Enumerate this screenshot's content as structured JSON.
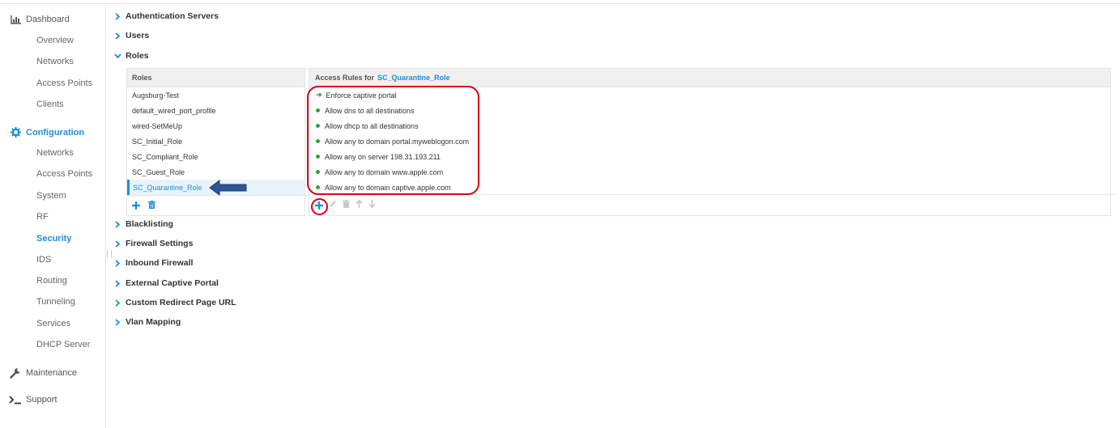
{
  "sidebar": {
    "dashboard": {
      "label": "Dashboard",
      "icon": "bar-chart-icon",
      "items": [
        "Overview",
        "Networks",
        "Access Points",
        "Clients"
      ]
    },
    "configuration": {
      "label": "Configuration",
      "icon": "gear-icon",
      "items": [
        "Networks",
        "Access Points",
        "System",
        "RF",
        "Security",
        "IDS",
        "Routing",
        "Tunneling",
        "Services",
        "DHCP Server"
      ],
      "active": "Security"
    },
    "maintenance": {
      "label": "Maintenance",
      "icon": "wrench-icon"
    },
    "support": {
      "label": "Support",
      "icon": "terminal-icon"
    }
  },
  "sections_top": [
    {
      "label": "Authentication Servers",
      "expanded": false
    },
    {
      "label": "Users",
      "expanded": false
    },
    {
      "label": "Roles",
      "expanded": true
    }
  ],
  "sections_bottom": [
    {
      "label": "Blacklisting"
    },
    {
      "label": "Firewall Settings"
    },
    {
      "label": "Inbound Firewall"
    },
    {
      "label": "External Captive Portal"
    },
    {
      "label": "Custom Redirect Page URL"
    },
    {
      "label": "Vlan Mapping"
    }
  ],
  "roles": {
    "header": "Roles",
    "items": [
      "Augsburg-Test",
      "default_wired_port_profile",
      "wired-SetMeUp",
      "SC_Initial_Role",
      "SC_Compliant_Role",
      "SC_Guest_Role",
      "SC_Quarantine_Role"
    ],
    "selected": "SC_Quarantine_Role"
  },
  "access_rules": {
    "header_prefix": "Access Rules for",
    "role_name": "SC_Quarantine_Role",
    "rules": [
      "Enforce captive portal",
      "Allow dns to all destinations",
      "Allow dhcp to all destinations",
      "Allow any to domain portal.myweblogon.com",
      "Allow any on server 198.31.193.211",
      "Allow any to domain www.apple.com",
      "Allow any to domain captive.apple.com"
    ]
  },
  "colors": {
    "accent": "#1f8fd6",
    "highlight_red": "#d9001b",
    "arrow_blue": "#2f5597",
    "rule_green": "#2ea52e"
  }
}
